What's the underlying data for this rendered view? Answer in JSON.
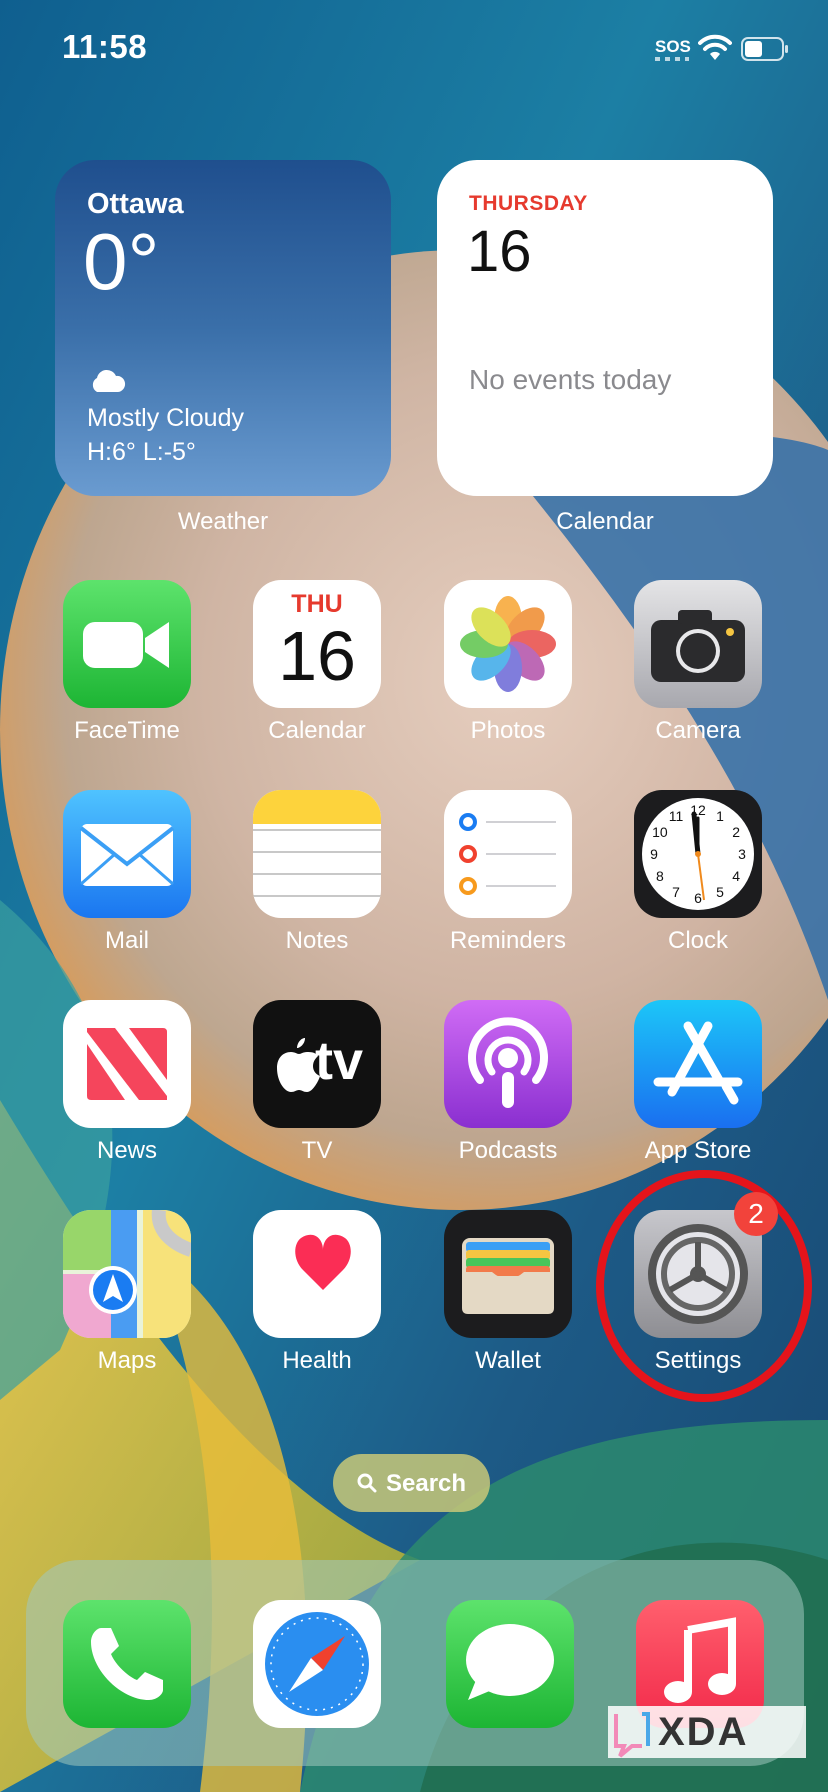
{
  "status_bar": {
    "time": "11:58",
    "sos": "SOS"
  },
  "widgets": {
    "weather": {
      "city": "Ottawa",
      "temperature": "0°",
      "condition": "Mostly Cloudy",
      "high_low": "H:6° L:-5°",
      "label": "Weather"
    },
    "calendar": {
      "weekday": "THURSDAY",
      "date": "16",
      "events": "No events today",
      "label": "Calendar"
    }
  },
  "apps": [
    {
      "name": "FaceTime",
      "icon": "facetime-icon"
    },
    {
      "name": "Calendar",
      "icon": "calendar-icon",
      "icon_day": "THU",
      "icon_date": "16"
    },
    {
      "name": "Photos",
      "icon": "photos-icon"
    },
    {
      "name": "Camera",
      "icon": "camera-icon"
    },
    {
      "name": "Mail",
      "icon": "mail-icon"
    },
    {
      "name": "Notes",
      "icon": "notes-icon"
    },
    {
      "name": "Reminders",
      "icon": "reminders-icon"
    },
    {
      "name": "Clock",
      "icon": "clock-icon",
      "clock_numbers": [
        "12",
        "1",
        "2",
        "3",
        "4",
        "5",
        "6",
        "7",
        "8",
        "9",
        "10",
        "11"
      ]
    },
    {
      "name": "News",
      "icon": "news-icon"
    },
    {
      "name": "TV",
      "icon": "tv-icon",
      "icon_text": "tv"
    },
    {
      "name": "Podcasts",
      "icon": "podcasts-icon"
    },
    {
      "name": "App Store",
      "icon": "app-store-icon"
    },
    {
      "name": "Maps",
      "icon": "maps-icon"
    },
    {
      "name": "Health",
      "icon": "health-icon"
    },
    {
      "name": "Wallet",
      "icon": "wallet-icon"
    },
    {
      "name": "Settings",
      "icon": "settings-icon",
      "badge": "2"
    }
  ],
  "search": {
    "label": "Search"
  },
  "dock": [
    {
      "name": "Phone",
      "icon": "phone-icon"
    },
    {
      "name": "Safari",
      "icon": "safari-icon"
    },
    {
      "name": "Messages",
      "icon": "messages-icon"
    },
    {
      "name": "Music",
      "icon": "music-icon"
    }
  ],
  "watermark": "XDA",
  "colors": {
    "badge": "#f2433b",
    "annotation": "#e5141b",
    "calendar_red": "#e63a2e"
  }
}
